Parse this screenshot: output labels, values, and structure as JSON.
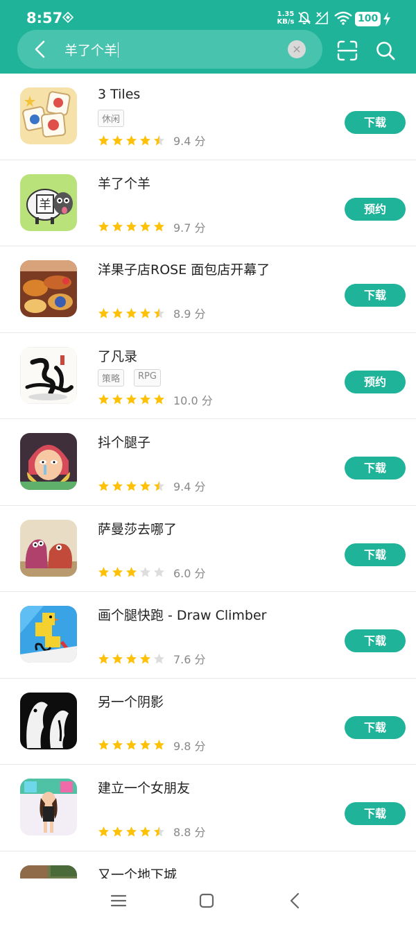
{
  "status": {
    "time": "8:57",
    "speed_value": "1.35",
    "speed_unit": "KB/s",
    "battery": "100"
  },
  "search": {
    "query": "羊了个羊",
    "clear_glyph": "×"
  },
  "colors": {
    "accent": "#1fb39a",
    "star": "#ffc107",
    "star_empty": "#dddddd"
  },
  "apps": [
    {
      "name": "3 Tiles",
      "tags": [
        "休闲"
      ],
      "rating": 4.5,
      "score": "9.4 分",
      "button": "下载"
    },
    {
      "name": "羊了个羊",
      "tags": [],
      "rating": 5,
      "score": "9.7 分",
      "button": "预约"
    },
    {
      "name": "洋果子店ROSE 面包店开幕了",
      "tags": [],
      "rating": 4.5,
      "score": "8.9 分",
      "button": "下载"
    },
    {
      "name": "了凡录",
      "tags": [
        "策略",
        "RPG"
      ],
      "rating": 5,
      "score": "10.0 分",
      "button": "预约"
    },
    {
      "name": "抖个腿子",
      "tags": [],
      "rating": 4.5,
      "score": "9.4 分",
      "button": "下载"
    },
    {
      "name": "萨曼莎去哪了",
      "tags": [],
      "rating": 3,
      "score": "6.0 分",
      "button": "下载"
    },
    {
      "name": "画个腿快跑 - Draw Climber",
      "tags": [],
      "rating": 4,
      "score": "7.6 分",
      "button": "下载"
    },
    {
      "name": "另一个阴影",
      "tags": [],
      "rating": 5,
      "score": "9.8 分",
      "button": "下载"
    },
    {
      "name": "建立一个女朋友",
      "tags": [],
      "rating": 4.5,
      "score": "8.8 分",
      "button": "下载"
    },
    {
      "name": "又一个地下城",
      "tags": [],
      "rating": null,
      "score": "",
      "button": ""
    }
  ],
  "icons": {
    "back": "back-arrow-icon",
    "scan": "scan-icon",
    "search": "search-icon",
    "nav": [
      "menu-icon",
      "home-icon",
      "back-icon"
    ]
  }
}
